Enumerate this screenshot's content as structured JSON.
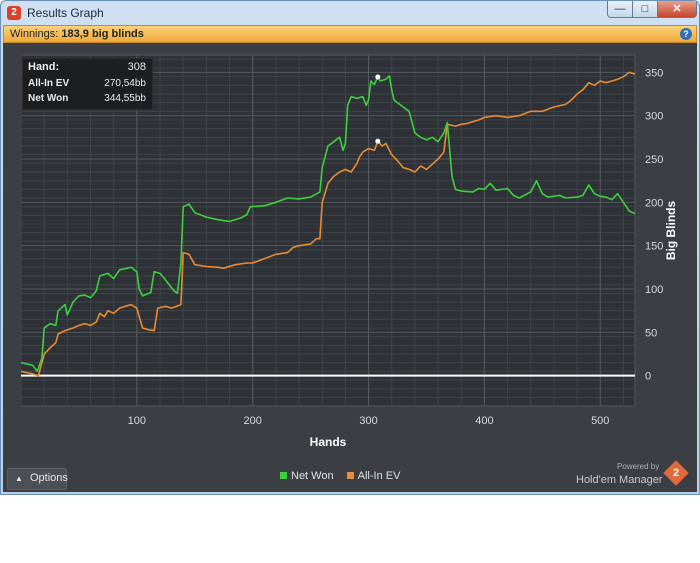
{
  "window": {
    "title": "Results Graph",
    "app_icon_label": "2",
    "minimize_glyph": "—",
    "maximize_glyph": "□",
    "close_glyph": "✕"
  },
  "winnings": {
    "label": "Winnings:",
    "value": "183,9 big blinds",
    "help_glyph": "?"
  },
  "tooltip": {
    "hand_label": "Hand:",
    "hand_value": "308",
    "allin_label": "All-In EV",
    "allin_value": "270,54bb",
    "netwon_label": "Net Won",
    "netwon_value": "344,55bb"
  },
  "options": {
    "label": "Options",
    "caret_glyph": "▲"
  },
  "branding": {
    "powered_by": "Powered by",
    "product": "Hold'em Manager",
    "logo_text": "2"
  },
  "colors": {
    "net_won": "#3ecf3e",
    "allin_ev": "#e98b34",
    "zero_line": "#ffffff",
    "background": "#3b3f44"
  },
  "chart_data": {
    "type": "line",
    "xlabel": "Hands",
    "ylabel": "Big Blinds",
    "xlim": [
      0,
      530
    ],
    "ylim": [
      -35,
      370
    ],
    "x_ticks": [
      100,
      200,
      300,
      400,
      500
    ],
    "y_ticks": [
      0,
      50,
      100,
      150,
      200,
      250,
      300,
      350
    ],
    "grid": true,
    "legend_position": "bottom-center",
    "series": [
      {
        "name": "Net Won",
        "color": "#3ecf3e",
        "points": [
          [
            0,
            15
          ],
          [
            10,
            12
          ],
          [
            14,
            5
          ],
          [
            18,
            20
          ],
          [
            20,
            55
          ],
          [
            25,
            60
          ],
          [
            30,
            58
          ],
          [
            32,
            75
          ],
          [
            38,
            82
          ],
          [
            40,
            70
          ],
          [
            45,
            85
          ],
          [
            50,
            92
          ],
          [
            55,
            93
          ],
          [
            60,
            90
          ],
          [
            65,
            98
          ],
          [
            68,
            115
          ],
          [
            75,
            118
          ],
          [
            80,
            112
          ],
          [
            85,
            122
          ],
          [
            95,
            125
          ],
          [
            100,
            120
          ],
          [
            102,
            100
          ],
          [
            105,
            92
          ],
          [
            112,
            96
          ],
          [
            115,
            120
          ],
          [
            120,
            118
          ],
          [
            125,
            110
          ],
          [
            132,
            98
          ],
          [
            135,
            95
          ],
          [
            138,
            130
          ],
          [
            140,
            195
          ],
          [
            145,
            198
          ],
          [
            150,
            188
          ],
          [
            160,
            183
          ],
          [
            170,
            180
          ],
          [
            180,
            178
          ],
          [
            190,
            182
          ],
          [
            195,
            186
          ],
          [
            198,
            195
          ],
          [
            210,
            196
          ],
          [
            220,
            200
          ],
          [
            230,
            205
          ],
          [
            240,
            204
          ],
          [
            250,
            206
          ],
          [
            258,
            212
          ],
          [
            260,
            240
          ],
          [
            265,
            265
          ],
          [
            270,
            270
          ],
          [
            275,
            275
          ],
          [
            278,
            260
          ],
          [
            280,
            268
          ],
          [
            282,
            312
          ],
          [
            285,
            322
          ],
          [
            290,
            320
          ],
          [
            295,
            322
          ],
          [
            298,
            312
          ],
          [
            300,
            318
          ],
          [
            302,
            340
          ],
          [
            305,
            336
          ],
          [
            308,
            345
          ],
          [
            310,
            340
          ],
          [
            315,
            342
          ],
          [
            318,
            346
          ],
          [
            320,
            330
          ],
          [
            322,
            318
          ],
          [
            330,
            310
          ],
          [
            335,
            305
          ],
          [
            340,
            280
          ],
          [
            345,
            275
          ],
          [
            350,
            272
          ],
          [
            355,
            275
          ],
          [
            360,
            270
          ],
          [
            365,
            280
          ],
          [
            368,
            292
          ],
          [
            372,
            230
          ],
          [
            375,
            215
          ],
          [
            380,
            213
          ],
          [
            390,
            212
          ],
          [
            395,
            216
          ],
          [
            400,
            215
          ],
          [
            405,
            222
          ],
          [
            410,
            214
          ],
          [
            420,
            216
          ],
          [
            425,
            208
          ],
          [
            430,
            205
          ],
          [
            440,
            212
          ],
          [
            445,
            225
          ],
          [
            450,
            210
          ],
          [
            455,
            206
          ],
          [
            465,
            208
          ],
          [
            470,
            205
          ],
          [
            480,
            206
          ],
          [
            485,
            208
          ],
          [
            490,
            220
          ],
          [
            495,
            210
          ],
          [
            500,
            207
          ],
          [
            505,
            206
          ],
          [
            510,
            203
          ],
          [
            515,
            210
          ],
          [
            520,
            200
          ],
          [
            525,
            190
          ],
          [
            530,
            187
          ]
        ]
      },
      {
        "name": "All-In EV",
        "color": "#e98b34",
        "points": [
          [
            0,
            5
          ],
          [
            10,
            2
          ],
          [
            15,
            0
          ],
          [
            20,
            25
          ],
          [
            25,
            32
          ],
          [
            30,
            38
          ],
          [
            32,
            48
          ],
          [
            38,
            52
          ],
          [
            45,
            55
          ],
          [
            50,
            58
          ],
          [
            55,
            60
          ],
          [
            60,
            58
          ],
          [
            65,
            62
          ],
          [
            68,
            72
          ],
          [
            72,
            68
          ],
          [
            75,
            75
          ],
          [
            80,
            72
          ],
          [
            85,
            78
          ],
          [
            90,
            80
          ],
          [
            95,
            82
          ],
          [
            100,
            78
          ],
          [
            105,
            55
          ],
          [
            110,
            53
          ],
          [
            115,
            52
          ],
          [
            118,
            78
          ],
          [
            125,
            80
          ],
          [
            130,
            78
          ],
          [
            138,
            82
          ],
          [
            140,
            142
          ],
          [
            145,
            140
          ],
          [
            150,
            128
          ],
          [
            160,
            126
          ],
          [
            170,
            125
          ],
          [
            175,
            124
          ],
          [
            185,
            128
          ],
          [
            195,
            130
          ],
          [
            200,
            130
          ],
          [
            210,
            135
          ],
          [
            220,
            140
          ],
          [
            230,
            142
          ],
          [
            235,
            148
          ],
          [
            240,
            150
          ],
          [
            250,
            152
          ],
          [
            255,
            158
          ],
          [
            258,
            158
          ],
          [
            260,
            200
          ],
          [
            265,
            222
          ],
          [
            270,
            230
          ],
          [
            275,
            235
          ],
          [
            280,
            238
          ],
          [
            285,
            235
          ],
          [
            290,
            245
          ],
          [
            292,
            252
          ],
          [
            295,
            258
          ],
          [
            300,
            262
          ],
          [
            305,
            260
          ],
          [
            308,
            270
          ],
          [
            312,
            265
          ],
          [
            315,
            268
          ],
          [
            320,
            255
          ],
          [
            325,
            248
          ],
          [
            330,
            240
          ],
          [
            335,
            238
          ],
          [
            340,
            235
          ],
          [
            345,
            242
          ],
          [
            350,
            238
          ],
          [
            355,
            244
          ],
          [
            360,
            250
          ],
          [
            365,
            258
          ],
          [
            368,
            290
          ],
          [
            375,
            288
          ],
          [
            380,
            290
          ],
          [
            385,
            291
          ],
          [
            390,
            293
          ],
          [
            395,
            295
          ],
          [
            400,
            298
          ],
          [
            410,
            300
          ],
          [
            420,
            298
          ],
          [
            430,
            300
          ],
          [
            440,
            305
          ],
          [
            450,
            305
          ],
          [
            460,
            310
          ],
          [
            470,
            313
          ],
          [
            475,
            318
          ],
          [
            480,
            325
          ],
          [
            485,
            330
          ],
          [
            490,
            338
          ],
          [
            495,
            335
          ],
          [
            500,
            340
          ],
          [
            505,
            338
          ],
          [
            510,
            340
          ],
          [
            515,
            342
          ],
          [
            520,
            345
          ],
          [
            525,
            350
          ],
          [
            530,
            348
          ]
        ]
      }
    ],
    "highlight": {
      "hand": 308,
      "net_won": 344.55,
      "allin_ev": 270.54
    }
  }
}
